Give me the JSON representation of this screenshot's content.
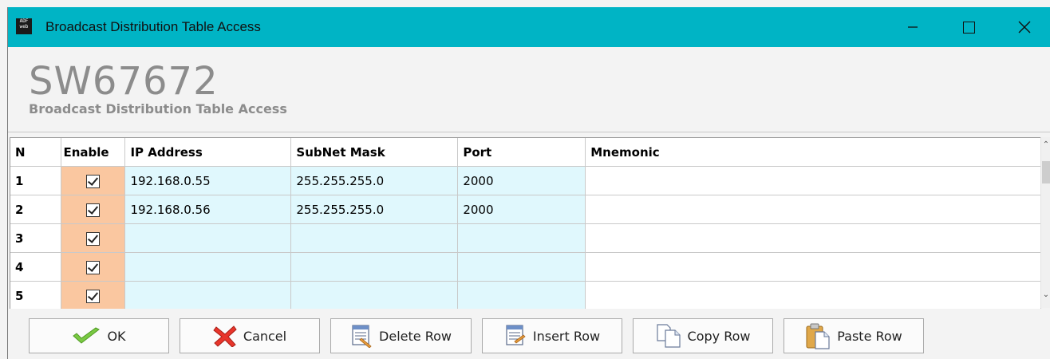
{
  "window": {
    "title": "Broadcast Distribution Table Access",
    "app_icon_text": "ADF web"
  },
  "header": {
    "title": "SW67672",
    "subtitle": "Broadcast Distribution Table Access"
  },
  "table": {
    "columns": [
      "N",
      "Enable",
      "IP Address",
      "SubNet Mask",
      "Port",
      "Mnemonic"
    ],
    "rows": [
      {
        "n": "1",
        "enabled": true,
        "ip": "192.168.0.55",
        "mask": "255.255.255.0",
        "port": "2000",
        "mnemonic": ""
      },
      {
        "n": "2",
        "enabled": true,
        "ip": "192.168.0.56",
        "mask": "255.255.255.0",
        "port": "2000",
        "mnemonic": ""
      },
      {
        "n": "3",
        "enabled": true,
        "ip": "",
        "mask": "",
        "port": "",
        "mnemonic": ""
      },
      {
        "n": "4",
        "enabled": true,
        "ip": "",
        "mask": "",
        "port": "",
        "mnemonic": ""
      },
      {
        "n": "5",
        "enabled": true,
        "ip": "",
        "mask": "",
        "port": "",
        "mnemonic": ""
      }
    ]
  },
  "buttons": {
    "ok": "OK",
    "cancel": "Cancel",
    "delete_row": "Delete Row",
    "insert_row": "Insert Row",
    "copy_row": "Copy Row",
    "paste_row": "Paste Row"
  },
  "colors": {
    "titlebar": "#00b4c5",
    "enable_column": "#fac7a0",
    "data_cells": "#e0f8fd",
    "header_text": "#8c8c8c"
  }
}
